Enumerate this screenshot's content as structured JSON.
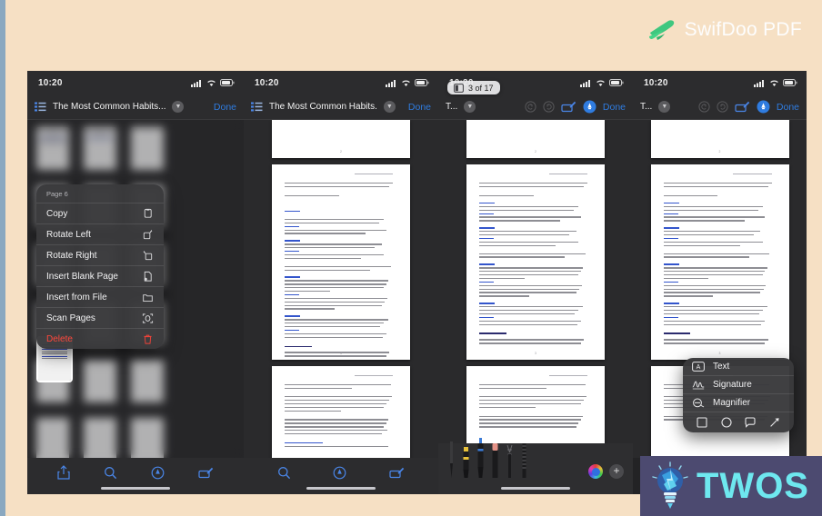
{
  "brand": {
    "name": "SwifDoo PDF",
    "logo_icon": "swallow-bird-icon",
    "accent": "#3fc77f"
  },
  "promo": {
    "label": "TWOS",
    "icon": "lightbulb-icon",
    "bg": "#4c4a70",
    "text_color": "#6ee8ef"
  },
  "colors": {
    "background": "#f6e0c4",
    "edge": "#8aa8c0",
    "ios_blue": "#2f7ce0",
    "destructive": "#ff453a",
    "chrome": "#2c2c2e"
  },
  "panels": [
    {
      "id": "panel-thumbnails",
      "status": {
        "time": "10:20",
        "cellular_icon": "signal-bars-icon",
        "wifi_icon": "wifi-icon",
        "battery_icon": "battery-icon"
      },
      "navbar": {
        "list_icon": "thumbnail-list-icon",
        "title": "The Most Common Habits...",
        "chevron_icon": "chevron-down-icon",
        "done_label": "Done"
      },
      "bottom_icons": [
        "share-icon",
        "search-icon",
        "markup-pen-icon",
        "edit-annotate-icon"
      ]
    },
    {
      "id": "panel-reader",
      "status": {
        "time": "10:20",
        "cellular_icon": "signal-bars-icon",
        "wifi_icon": "wifi-icon",
        "battery_icon": "battery-icon"
      },
      "navbar": {
        "list_icon": "thumbnail-list-icon",
        "title": "The Most Common Habits...",
        "chevron_icon": "chevron-down-icon",
        "done_label": "Done"
      },
      "page_badge": {
        "icon": "page-view-icon",
        "label": "3 of 17"
      },
      "bottom_icons": [
        "search-icon",
        "markup-pen-icon",
        "edit-annotate-icon"
      ]
    },
    {
      "id": "panel-markup",
      "status": {
        "time": "10:20",
        "cellular_icon": "signal-bars-icon",
        "wifi_icon": "wifi-icon",
        "battery_icon": "battery-icon"
      },
      "navbar": {
        "title": "T...",
        "chevron_icon": "chevron-down-icon",
        "undo_icon": "undo-icon",
        "redo_icon": "redo-icon",
        "markup_icon": "markup-pen-icon",
        "avatar_icon": "annotate-avatar-icon",
        "done_label": "Done"
      },
      "tools": [
        "pen-tool",
        "highlighter-tool",
        "pencil-tool",
        "eraser-tool",
        "lasso-tool",
        "ruler-tool"
      ],
      "color_wheel_icon": "color-wheel-icon",
      "add_icon": "plus-icon"
    },
    {
      "id": "panel-annotate",
      "status": {
        "time": "10:20",
        "cellular_icon": "signal-bars-icon",
        "wifi_icon": "wifi-icon",
        "battery_icon": "battery-icon"
      },
      "navbar": {
        "title": "T...",
        "chevron_icon": "chevron-down-icon",
        "undo_icon": "undo-icon",
        "redo_icon": "redo-icon",
        "markup_icon": "markup-pen-icon",
        "avatar_icon": "annotate-avatar-icon",
        "done_label": "Done"
      }
    }
  ],
  "context_menu": {
    "header": "Page 6",
    "items": [
      {
        "label": "Copy",
        "icon": "copy-icon",
        "danger": false
      },
      {
        "label": "Rotate Left",
        "icon": "rotate-left-icon",
        "danger": false
      },
      {
        "label": "Rotate Right",
        "icon": "rotate-right-icon",
        "danger": false
      },
      {
        "label": "Insert Blank Page",
        "icon": "insert-blank-page-icon",
        "danger": false
      },
      {
        "label": "Insert from File",
        "icon": "folder-icon",
        "danger": false
      },
      {
        "label": "Scan Pages",
        "icon": "scan-icon",
        "danger": false
      },
      {
        "label": "Delete",
        "icon": "trash-icon",
        "danger": true
      }
    ]
  },
  "annotation_popup": {
    "items": [
      {
        "label": "Text",
        "icon": "text-box-icon"
      },
      {
        "label": "Signature",
        "icon": "signature-icon"
      },
      {
        "label": "Magnifier",
        "icon": "magnifier-icon"
      }
    ],
    "shapes": [
      "square-shape-icon",
      "circle-shape-icon",
      "speech-bubble-shape-icon",
      "arrow-shape-icon"
    ]
  }
}
